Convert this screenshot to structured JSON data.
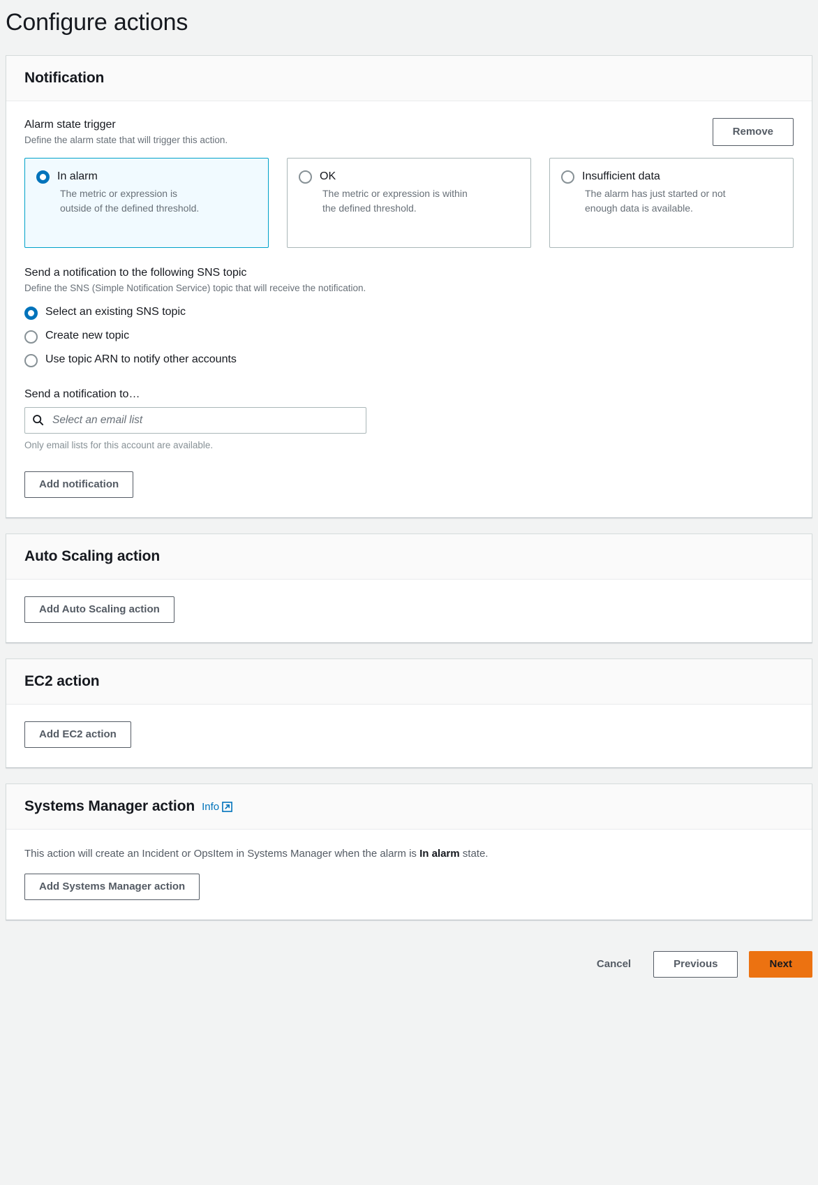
{
  "page": {
    "title": "Configure actions"
  },
  "notification": {
    "header": "Notification",
    "alarm_state_trigger": {
      "label": "Alarm state trigger",
      "description": "Define the alarm state that will trigger this action.",
      "remove_label": "Remove",
      "options": [
        {
          "title": "In alarm",
          "description": "The metric or expression is outside of the defined threshold.",
          "selected": true
        },
        {
          "title": "OK",
          "description": "The metric or expression is within the defined threshold.",
          "selected": false
        },
        {
          "title": "Insufficient data",
          "description": "The alarm has just started or not enough data is available.",
          "selected": false
        }
      ]
    },
    "sns": {
      "label": "Send a notification to the following SNS topic",
      "description": "Define the SNS (Simple Notification Service) topic that will receive the notification.",
      "options": [
        {
          "label": "Select an existing SNS topic",
          "selected": true
        },
        {
          "label": "Create new topic",
          "selected": false
        },
        {
          "label": "Use topic ARN to notify other accounts",
          "selected": false
        }
      ]
    },
    "send_to": {
      "label": "Send a notification to…",
      "placeholder": "Select an email list",
      "value": "",
      "hint": "Only email lists for this account are available.",
      "icon": "search-icon"
    },
    "add_notification_label": "Add notification"
  },
  "auto_scaling": {
    "header": "Auto Scaling action",
    "add_label": "Add Auto Scaling action"
  },
  "ec2": {
    "header": "EC2 action",
    "add_label": "Add EC2 action"
  },
  "systems_manager": {
    "header": "Systems Manager action",
    "info_label": "Info",
    "info_icon": "external-link-icon",
    "description_prefix": "This action will create an Incident or OpsItem in Systems Manager when the alarm is ",
    "description_bold": "In alarm",
    "description_suffix": " state.",
    "add_label": "Add Systems Manager action"
  },
  "footer": {
    "cancel_label": "Cancel",
    "previous_label": "Previous",
    "next_label": "Next"
  },
  "colors": {
    "accent_blue": "#0073bb",
    "selected_border": "#00a1c9",
    "selected_bg": "#f1faff",
    "primary_button": "#ec7211",
    "link": "#0073bb"
  }
}
